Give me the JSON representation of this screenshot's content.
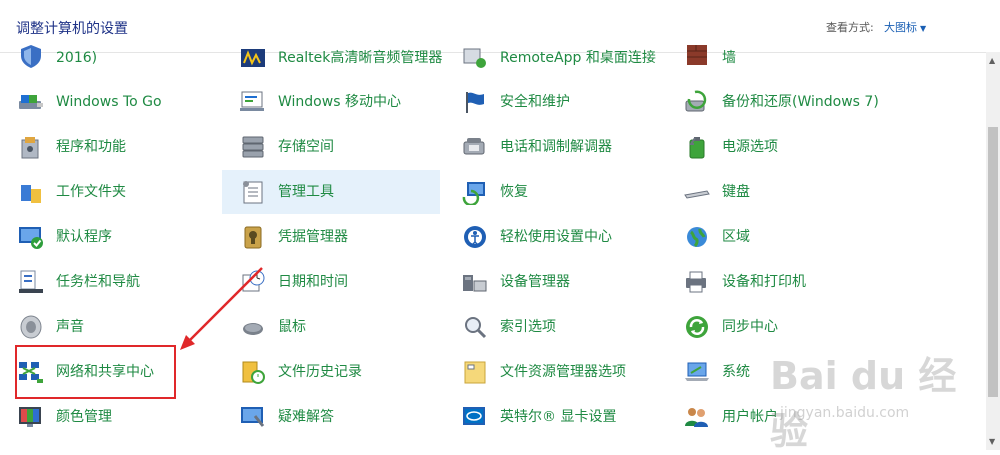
{
  "header": {
    "title": "调整计算机的设置",
    "view_by_label": "查看方式:",
    "view_by_value": "大图标"
  },
  "items": {
    "c0r0": "2016)",
    "c0r1": "Windows To Go",
    "c0r2": "程序和功能",
    "c0r3": "工作文件夹",
    "c0r4": "默认程序",
    "c0r5": "任务栏和导航",
    "c0r6": "声音",
    "c0r7": "网络和共享中心",
    "c0r8": "颜色管理",
    "c1r0": "Realtek高清晰音频管理器",
    "c1r1": "Windows 移动中心",
    "c1r2": "存储空间",
    "c1r3": "管理工具",
    "c1r4": "凭据管理器",
    "c1r5": "日期和时间",
    "c1r6": "鼠标",
    "c1r7": "文件历史记录",
    "c1r8": "疑难解答",
    "c2r0": "RemoteApp 和桌面连接",
    "c2r1": "安全和维护",
    "c2r2": "电话和调制解调器",
    "c2r3": "恢复",
    "c2r4": "轻松使用设置中心",
    "c2r5": "设备管理器",
    "c2r6": "索引选项",
    "c2r7": "文件资源管理器选项",
    "c2r8": "英特尔® 显卡设置",
    "c3r0": "墙",
    "c3r1": "备份和还原(Windows 7)",
    "c3r2": "电源选项",
    "c3r3": "键盘",
    "c3r4": "区域",
    "c3r5": "设备和打印机",
    "c3r6": "同步中心",
    "c3r7": "系统",
    "c3r8": "用户帐户"
  },
  "watermark": {
    "main": "Bai du 经验",
    "sub": "jingyan.baidu.com"
  },
  "colors": {
    "link_green": "#1f8a43",
    "title_blue": "#1e3287",
    "selected_bg": "#e5f1fb",
    "annotation_red": "#e0282a"
  }
}
